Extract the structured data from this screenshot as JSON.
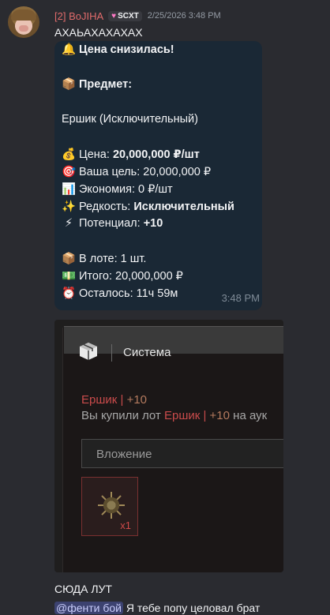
{
  "message": {
    "author": "[2] BoJIHA",
    "tag": "SCXT",
    "timestamp": "2/25/2026 3:48 PM",
    "text": "АХАЬАХАХАХАХ"
  },
  "bubble": {
    "lines": [
      {
        "emoji": "🔔",
        "label": "Цена снизилась!",
        "value": ""
      },
      {
        "emoji": "📦",
        "label": "Предмет:",
        "value": ""
      },
      {
        "emoji": "",
        "label": "Ершик (Исключительный)",
        "value": ""
      },
      {
        "emoji": "💰",
        "label": "Цена:",
        "value": "20,000,000 ₽/шт"
      },
      {
        "emoji": "🎯",
        "label": "Ваша цель: 20,000,000 ₽",
        "value": ""
      },
      {
        "emoji": "📊",
        "label": "Экономия: 0 ₽/шт",
        "value": ""
      },
      {
        "emoji": "✨",
        "label": "Редкость:",
        "value": "Исключительный"
      },
      {
        "emoji": "⚡",
        "label": "Потенциал:",
        "value": "+10"
      },
      {
        "emoji": "📦",
        "label": "В лоте: 1 шт.",
        "value": ""
      },
      {
        "emoji": "💵",
        "label": "Итого: 20,000,000 ₽",
        "value": ""
      },
      {
        "emoji": "⏰",
        "label": "Осталось: 11ч 59м",
        "value": ""
      }
    ],
    "time": "3:48 PM"
  },
  "embed": {
    "title": "Система",
    "item_name": "Ершик",
    "item_sep": "|",
    "item_level": "+10",
    "buy_prefix": "Вы купили лот",
    "buy_suffix": "на аук",
    "attachment_label": "Вложение",
    "slot_qty": "x1"
  },
  "messages": [
    {
      "text": "СЮДА ЛУТ"
    },
    {
      "mention": "@фенти бой",
      "text": " Я тебе попу целовал брат"
    }
  ],
  "colors": {
    "background": "#2a2b30",
    "username": "#e06b6b",
    "bubble": "#1a2835",
    "accent_red": "#c94b4b"
  }
}
